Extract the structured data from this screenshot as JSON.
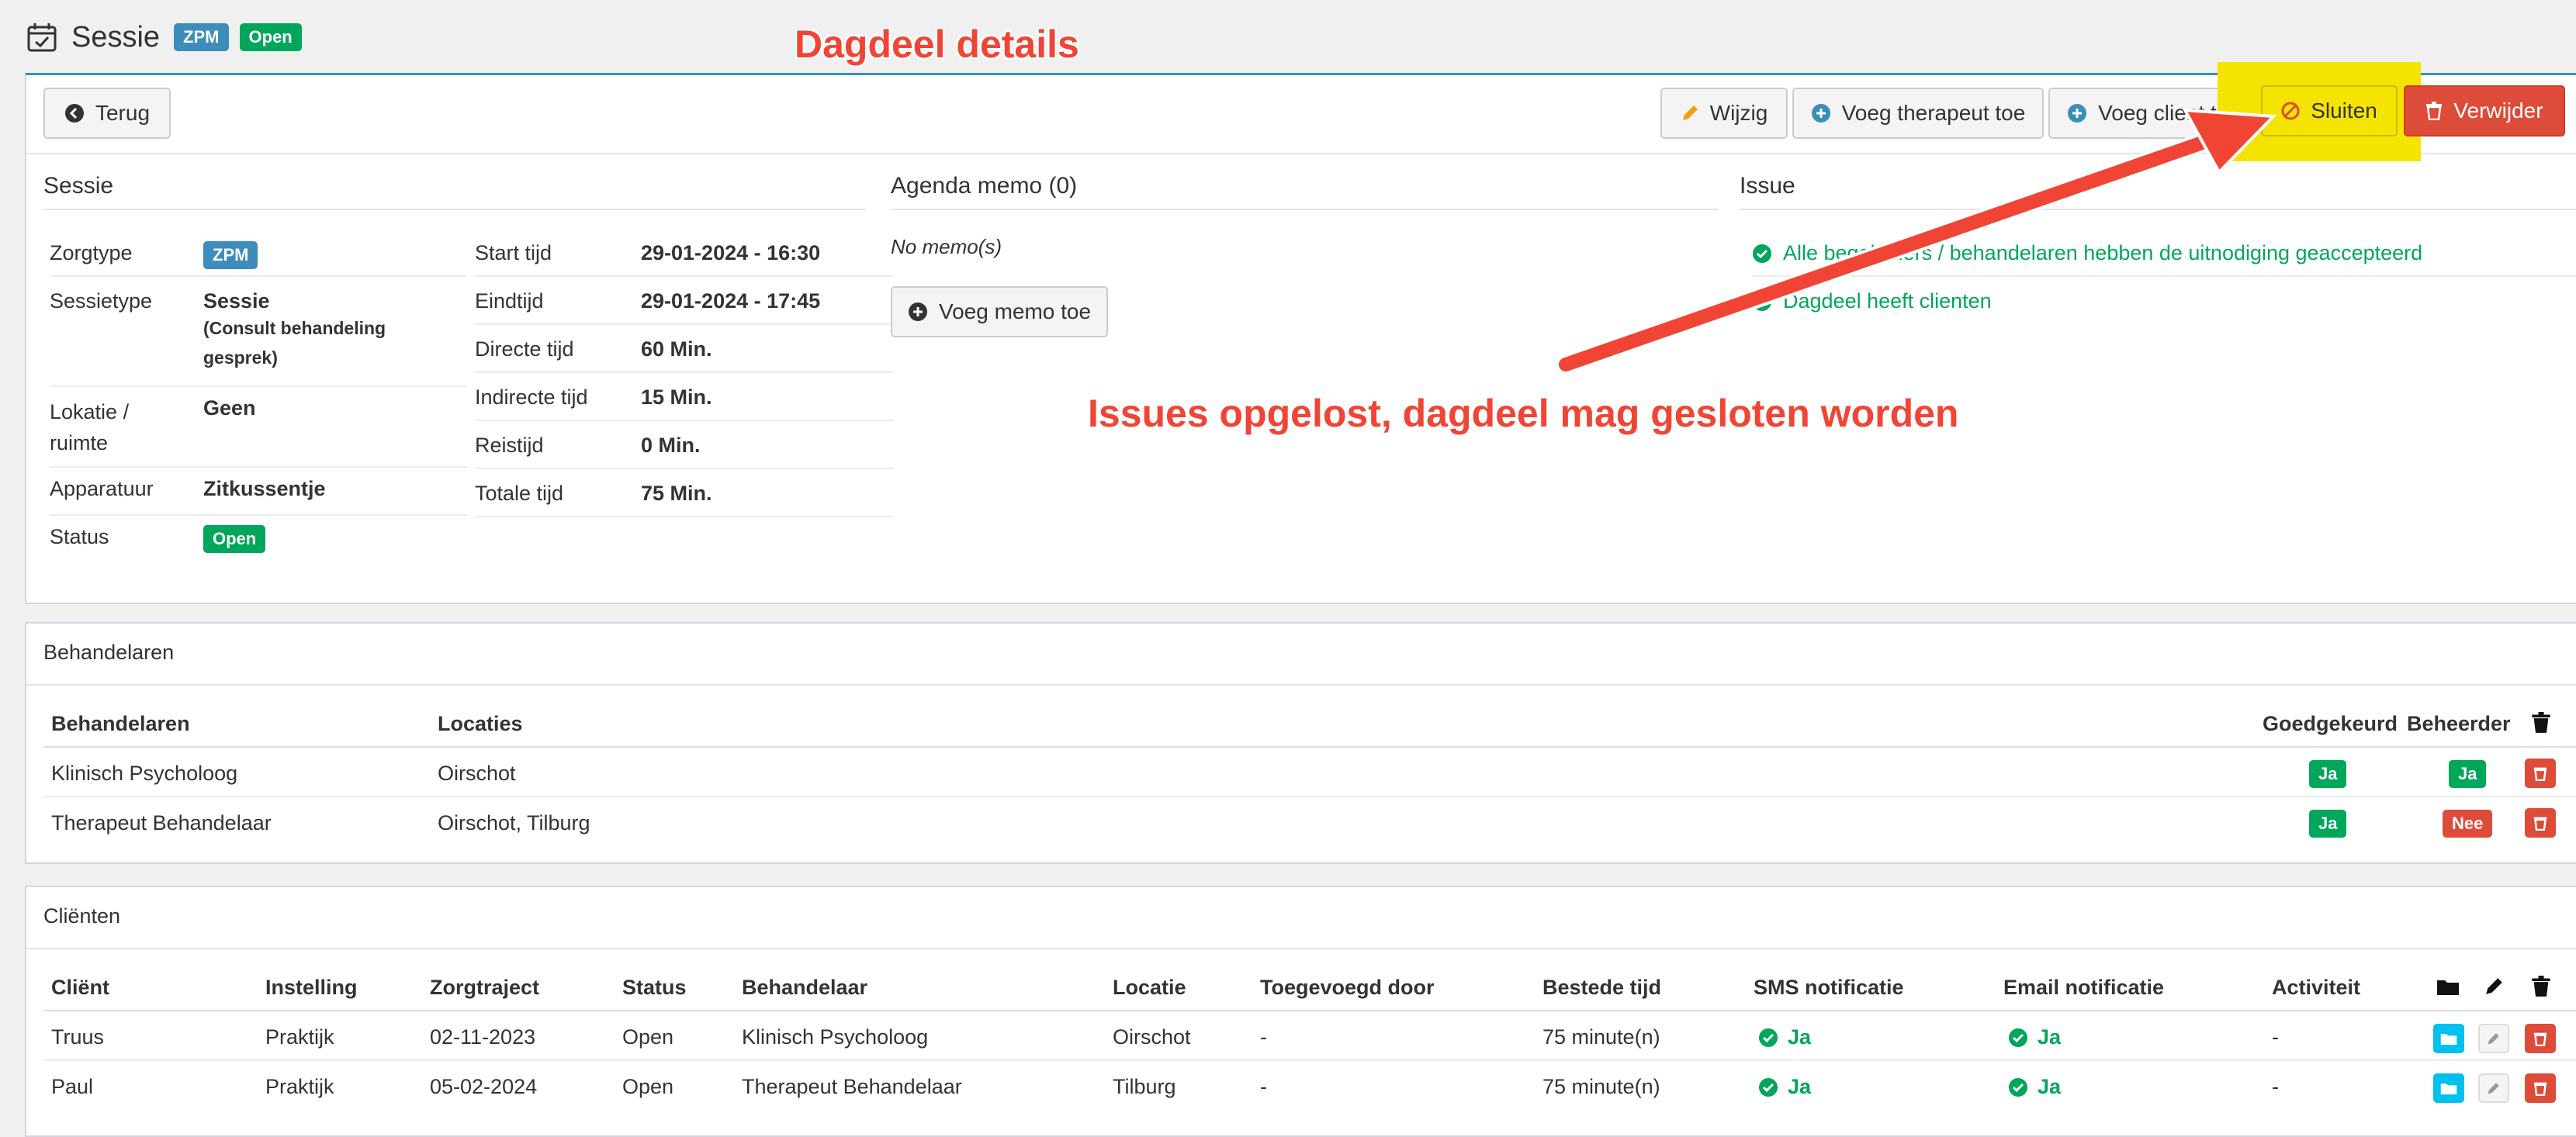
{
  "header": {
    "title": "Sessie",
    "badge_type": "ZPM",
    "badge_status": "Open"
  },
  "annotations": {
    "title": "Dagdeel details",
    "note": "Issues opgelost, dagdeel mag gesloten worden"
  },
  "toolbar": {
    "back": "Terug",
    "edit": "Wijzig",
    "add_therapist": "Voeg therapeut toe",
    "add_client": "Voeg client toe",
    "close": "Sluiten",
    "delete": "Verwijder"
  },
  "sessie": {
    "title": "Sessie",
    "zorgtype_label": "Zorgtype",
    "zorgtype_value": "ZPM",
    "sessietype_label": "Sessietype",
    "sessietype_value": "Sessie",
    "sessietype_sub": "(Consult behandeling gesprek)",
    "lokatie_label": "Lokatie / ruimte",
    "lokatie_value": "Geen",
    "apparatuur_label": "Apparatuur",
    "apparatuur_value": "Zitkussentje",
    "status_label": "Status",
    "status_value": "Open"
  },
  "times": {
    "start_label": "Start tijd",
    "start_value": "29-01-2024 - 16:30",
    "end_label": "Eindtijd",
    "end_value": "29-01-2024 - 17:45",
    "direct_label": "Directe tijd",
    "direct_value": "60 Min.",
    "indirect_label": "Indirecte tijd",
    "indirect_value": "15 Min.",
    "travel_label": "Reistijd",
    "travel_value": "0 Min.",
    "total_label": "Totale tijd",
    "total_value": "75 Min."
  },
  "memo": {
    "title": "Agenda memo (0)",
    "empty": "No memo(s)",
    "add": "Voeg memo toe"
  },
  "issue": {
    "title": "Issue",
    "line1": "Alle begeleiders / behandelaren hebben de uitnodiging geaccepteerd",
    "line2": "Dagdeel heeft clienten"
  },
  "behandelaren": {
    "title": "Behandelaren",
    "headers": {
      "name": "Behandelaren",
      "loc": "Locaties",
      "approved": "Goedgekeurd",
      "admin": "Beheerder"
    },
    "rows": [
      {
        "name": "Klinisch Psycholoog",
        "loc": "Oirschot",
        "approved": "Ja",
        "admin": "Ja"
      },
      {
        "name": "Therapeut Behandelaar",
        "loc": "Oirschot, Tilburg",
        "approved": "Ja",
        "admin": "Nee"
      }
    ]
  },
  "clienten": {
    "title": "Cliënten",
    "headers": {
      "client": "Cliënt",
      "inst": "Instelling",
      "traj": "Zorgtraject",
      "status": "Status",
      "beh": "Behandelaar",
      "loc": "Locatie",
      "by": "Toegevoegd door",
      "time": "Bestede tijd",
      "sms": "SMS notificatie",
      "email": "Email notificatie",
      "act": "Activiteit"
    },
    "rows": [
      {
        "client": "Truus",
        "inst": "Praktijk",
        "traj": "02-11-2023",
        "status": "Open",
        "beh": "Klinisch Psycholoog",
        "loc": "Oirschot",
        "by": "-",
        "time": "75 minute(n)",
        "sms": "Ja",
        "email": "Ja",
        "act": "-"
      },
      {
        "client": "Paul",
        "inst": "Praktijk",
        "traj": "05-02-2024",
        "status": "Open",
        "beh": "Therapeut Behandelaar",
        "loc": "Tilburg",
        "by": "-",
        "time": "75 minute(n)",
        "sms": "Ja",
        "email": "Ja",
        "act": "-"
      }
    ]
  },
  "colors": {
    "accent": "#3c8dbc",
    "success": "#00a65a",
    "danger": "#dd4b39",
    "highlight": "#f5e400",
    "annotation": "#f04535"
  }
}
